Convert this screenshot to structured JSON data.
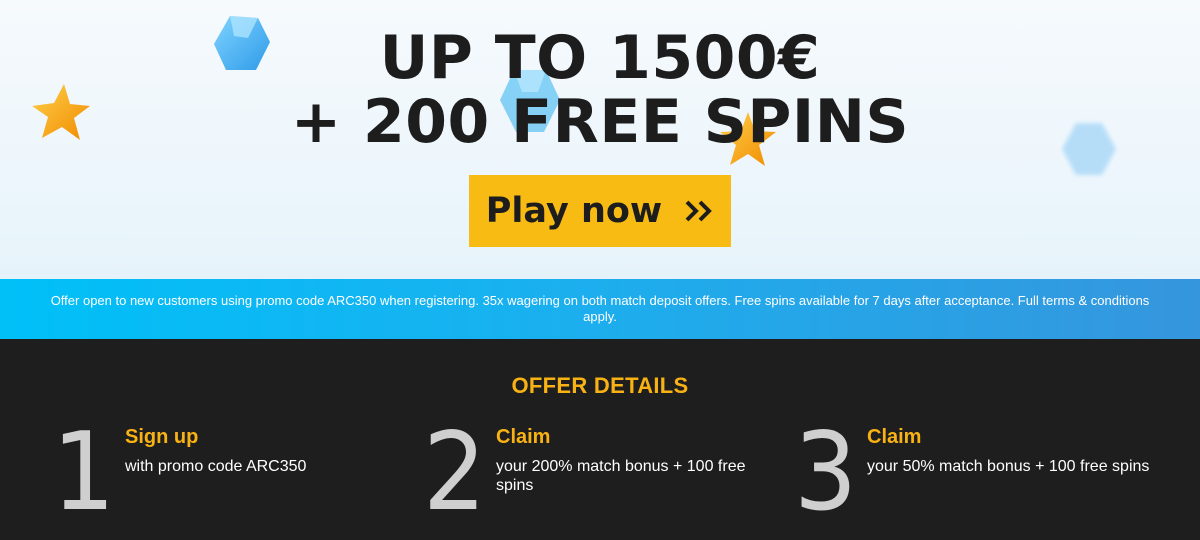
{
  "hero": {
    "headline_line1": "UP TO 1500€",
    "headline_line2": "+ 200 FREE SPINS",
    "cta_label": "Play now",
    "cta_icon": "double-chevron-right-icon",
    "decorations": [
      "blue-gem-icon",
      "star-icon"
    ]
  },
  "terms": {
    "text": "Offer open to new customers using promo code ARC350 when registering. 35x wagering on both match deposit offers. Free spins available for 7 days after acceptance. Full terms & conditions apply."
  },
  "details": {
    "title": "OFFER DETAILS",
    "steps": [
      {
        "number": "1",
        "title": "Sign up",
        "text": "with promo code ARC350"
      },
      {
        "number": "2",
        "title": "Claim",
        "text": "your 200% match bonus + 100 free spins"
      },
      {
        "number": "3",
        "title": "Claim",
        "text": "your 50% match bonus + 100 free spins"
      }
    ]
  },
  "colors": {
    "accent_yellow": "#f8bb14",
    "headline": "#1d1d1d",
    "terms_bar_start": "#00c0f8",
    "terms_bar_end": "#3596dd",
    "details_bg": "#1e1e1e",
    "step_title": "#f8b214"
  }
}
